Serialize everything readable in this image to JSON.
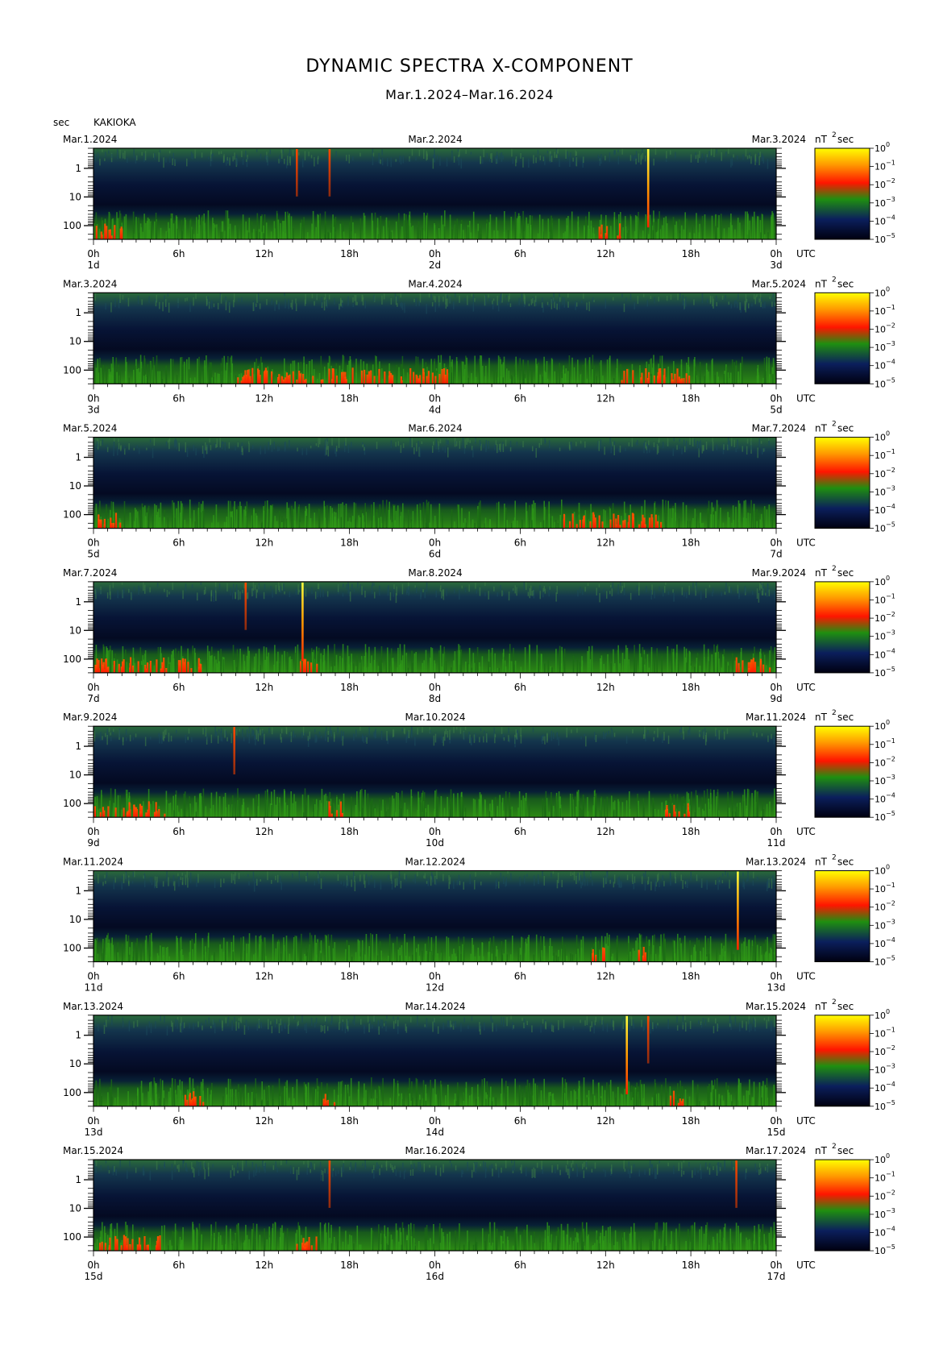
{
  "title": "DYNAMIC SPECTRA X-COMPONENT",
  "subtitle": "Mar.1.2024–Mar.16.2024",
  "unit_label": "sec",
  "station": "KAKIOKA",
  "colorbar": {
    "label_base": "nT",
    "label_exp": "2",
    "label_unit": "sec",
    "ticks": [
      "10",
      "10",
      "10",
      "10",
      "10",
      "10"
    ],
    "tick_exps": [
      "0",
      "−1",
      "−2",
      "−3",
      "−4",
      "−5"
    ],
    "colors": [
      "#ffff00",
      "#ff8800",
      "#ff2200",
      "#2a8a12",
      "#0a1a55",
      "#000010"
    ]
  },
  "chart_data": {
    "type": "heatmap",
    "quantity": "dynamic spectra X-component power",
    "y_axis": {
      "label": "sec",
      "scale": "log",
      "range": [
        0.2,
        300
      ],
      "tick_labels": [
        "1",
        "10",
        "100"
      ]
    },
    "x_axis": {
      "tick_labels": [
        "0h",
        "6h",
        "12h",
        "18h",
        "0h",
        "6h",
        "12h",
        "18h",
        "0h"
      ],
      "timezone": "UTC"
    },
    "color_scale": {
      "unit": "nT^2 sec",
      "range": [
        1e-05,
        1
      ],
      "scale": "log"
    },
    "panels": [
      {
        "left_date": "Mar.1.2024",
        "mid_date": "Mar.2.2024",
        "right_date": "Mar.3.2024",
        "day_labels": [
          "1d",
          "2d",
          "3d"
        ],
        "spikes": [
          {
            "hour": 14.3,
            "intensity": "red"
          },
          {
            "hour": 16.6,
            "intensity": "red"
          },
          {
            "hour": 39.0,
            "intensity": "yellow"
          }
        ],
        "activity": [
          {
            "start": 0,
            "end": 2,
            "level": "red"
          },
          {
            "start": 35.5,
            "end": 37,
            "level": "red"
          }
        ]
      },
      {
        "left_date": "Mar.3.2024",
        "mid_date": "Mar.4.2024",
        "right_date": "Mar.5.2024",
        "day_labels": [
          "3d",
          "4d",
          "5d"
        ],
        "spikes": [],
        "activity": [
          {
            "start": 10,
            "end": 25,
            "level": "red"
          },
          {
            "start": 37,
            "end": 42,
            "level": "red"
          }
        ]
      },
      {
        "left_date": "Mar.5.2024",
        "mid_date": "Mar.6.2024",
        "right_date": "Mar.7.2024",
        "day_labels": [
          "5d",
          "6d",
          "7d"
        ],
        "spikes": [],
        "activity": [
          {
            "start": 0,
            "end": 2,
            "level": "red"
          },
          {
            "start": 33,
            "end": 40,
            "level": "red"
          }
        ]
      },
      {
        "left_date": "Mar.7.2024",
        "mid_date": "Mar.8.2024",
        "right_date": "Mar.9.2024",
        "day_labels": [
          "7d",
          "8d",
          "9d"
        ],
        "spikes": [
          {
            "hour": 10.7,
            "intensity": "red"
          },
          {
            "hour": 14.7,
            "intensity": "yellow"
          }
        ],
        "activity": [
          {
            "start": 0,
            "end": 8,
            "level": "red"
          },
          {
            "start": 14.5,
            "end": 16,
            "level": "red"
          },
          {
            "start": 45,
            "end": 47.5,
            "level": "red"
          }
        ]
      },
      {
        "left_date": "Mar.9.2024",
        "mid_date": "Mar.10.2024",
        "right_date": "Mar.11.2024",
        "day_labels": [
          "9d",
          "10d",
          "11d"
        ],
        "spikes": [
          {
            "hour": 9.9,
            "intensity": "red"
          }
        ],
        "activity": [
          {
            "start": 0,
            "end": 5,
            "level": "red"
          },
          {
            "start": 16.5,
            "end": 17.5,
            "level": "red"
          },
          {
            "start": 40,
            "end": 42,
            "level": "red"
          }
        ]
      },
      {
        "left_date": "Mar.11.2024",
        "mid_date": "Mar.12.2024",
        "right_date": "Mar.13.2024",
        "day_labels": [
          "11d",
          "12d",
          "13d"
        ],
        "spikes": [
          {
            "hour": 45.3,
            "intensity": "yellow"
          }
        ],
        "activity": [
          {
            "start": 35,
            "end": 36,
            "level": "red"
          },
          {
            "start": 38,
            "end": 39,
            "level": "red"
          }
        ]
      },
      {
        "left_date": "Mar.13.2024",
        "mid_date": "Mar.14.2024",
        "right_date": "Mar.15.2024",
        "day_labels": [
          "13d",
          "14d",
          "15d"
        ],
        "spikes": [
          {
            "hour": 37.5,
            "intensity": "yellow"
          },
          {
            "hour": 39.0,
            "intensity": "red"
          }
        ],
        "activity": [
          {
            "start": 16,
            "end": 17,
            "level": "red"
          },
          {
            "start": 40.5,
            "end": 41.5,
            "level": "red"
          },
          {
            "start": 6,
            "end": 8,
            "level": "red"
          }
        ]
      },
      {
        "left_date": "Mar.15.2024",
        "mid_date": "Mar.16.2024",
        "right_date": "Mar.17.2024",
        "day_labels": [
          "15d",
          "16d",
          "17d"
        ],
        "spikes": [
          {
            "hour": 16.6,
            "intensity": "red"
          },
          {
            "hour": 45.2,
            "intensity": "red"
          }
        ],
        "activity": [
          {
            "start": 0,
            "end": 5,
            "level": "red"
          },
          {
            "start": 14,
            "end": 16,
            "level": "red"
          }
        ]
      }
    ]
  }
}
